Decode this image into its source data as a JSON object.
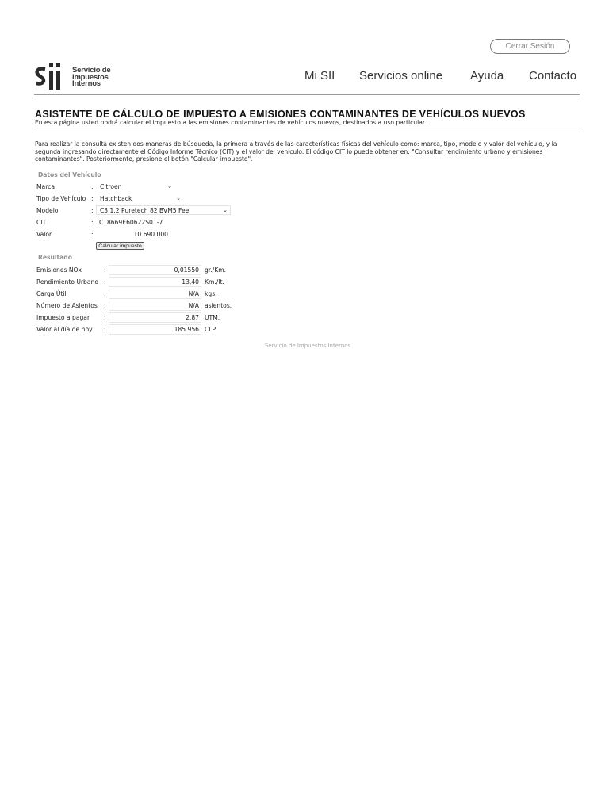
{
  "header": {
    "logout_label": "Cerrar Sesión",
    "logo": {
      "line1": "Servicio de",
      "line2": "Impuestos",
      "line3": "Internos"
    },
    "nav": [
      "Mi SII",
      "Servicios online",
      "Ayuda",
      "Contacto"
    ]
  },
  "page": {
    "title": "ASISTENTE DE CÁLCULO DE IMPUESTO A EMISIONES CONTAMINANTES DE VEHÍCULOS NUEVOS",
    "subtitle": "En esta página usted podrá calcular el impuesto a las emisiones contaminantes de vehículos nuevos, destinados a uso particular.",
    "intro": "Para realizar la consulta existen dos maneras de búsqueda, la primera a través de las características físicas del vehículo como: marca, tipo, modelo y valor del vehículo, y la segunda ingresando directamente el Código Informe Técnico (CIT) y el valor del vehículo. El código CIT lo puede obtener en: \"Consultar rendimiento urbano y emisiones contaminantes\". Posteriormente, presione el botón \"Calcular impuesto\"."
  },
  "vehicle": {
    "section_label": "Datos del Vehículo",
    "colon": ":",
    "marca_label": "Marca",
    "marca_value": "Citroen",
    "tipo_label": "Tipo de Vehículo",
    "tipo_value": "Hatchback",
    "modelo_label": "Modelo",
    "modelo_value": "C3 1.2 Puretech 82 BVM5 Feel",
    "cit_label": "CIT",
    "cit_value": "CT8669E60622S01-7",
    "valor_label": "Valor",
    "valor_value": "10.690.000",
    "button_label": "Calcular impuesto",
    "chevron": "⌄"
  },
  "result": {
    "section_label": "Resultado",
    "rows": [
      {
        "label": "Emisiones NOx",
        "value": "0,01550",
        "unit": "gr./Km."
      },
      {
        "label": "Rendimiento Urbano",
        "value": "13,40",
        "unit": "Km./lt."
      },
      {
        "label": "Carga Útil",
        "value": "N/A",
        "unit": "kgs."
      },
      {
        "label": "Número de Asientos",
        "value": "N/A",
        "unit": "asientos."
      },
      {
        "label": "Impuesto a pagar",
        "value": "2,87",
        "unit": "UTM."
      },
      {
        "label": "Valor al día de hoy",
        "value": "185.956",
        "unit": "CLP"
      }
    ]
  },
  "footer": "Servicio de Impuestos Internos"
}
